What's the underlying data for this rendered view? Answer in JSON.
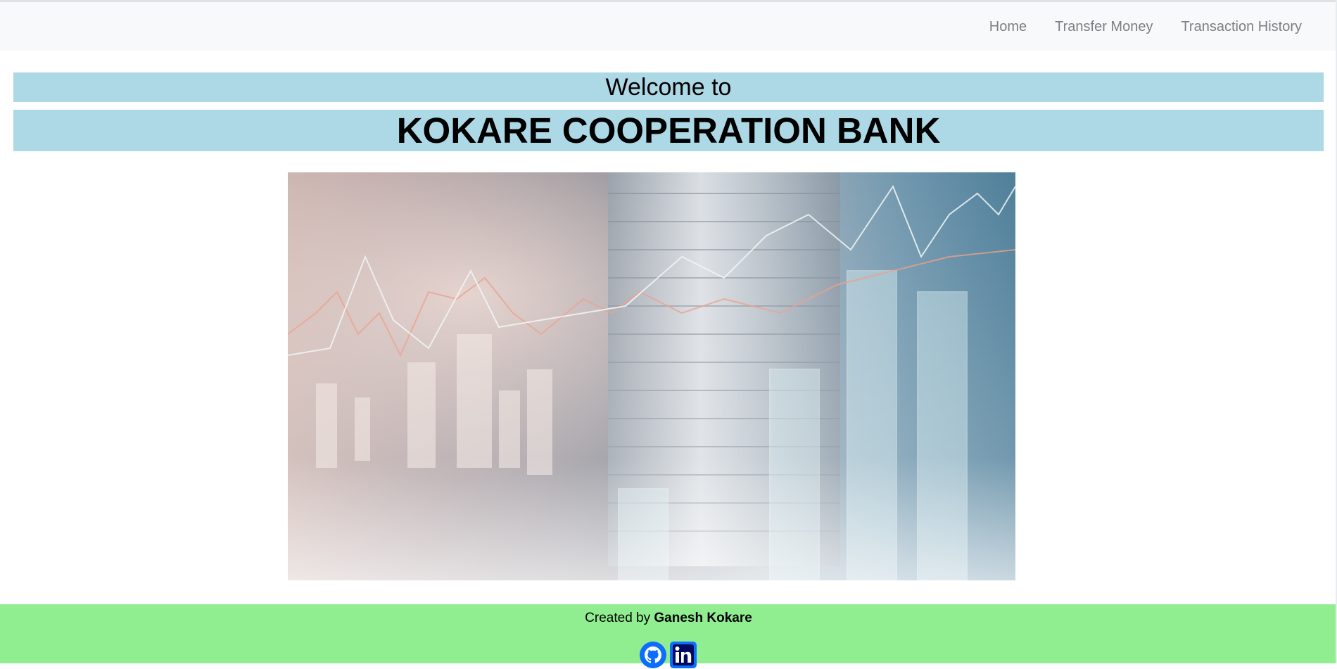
{
  "nav": {
    "links": [
      "Home",
      "Transfer Money",
      "Transaction History"
    ]
  },
  "banner": {
    "welcome": "Welcome to",
    "bank_name": "KOKARE COOPERATION BANK"
  },
  "footer": {
    "credit_prefix": "Created by",
    "credit_name": "Ganesh Kokare"
  },
  "colors": {
    "banner_bg": "#add8e6",
    "footer_bg": "#90ee90",
    "navbar_bg": "#f8f9fa"
  },
  "icons": {
    "social": [
      "github-icon",
      "linkedin-icon"
    ]
  }
}
